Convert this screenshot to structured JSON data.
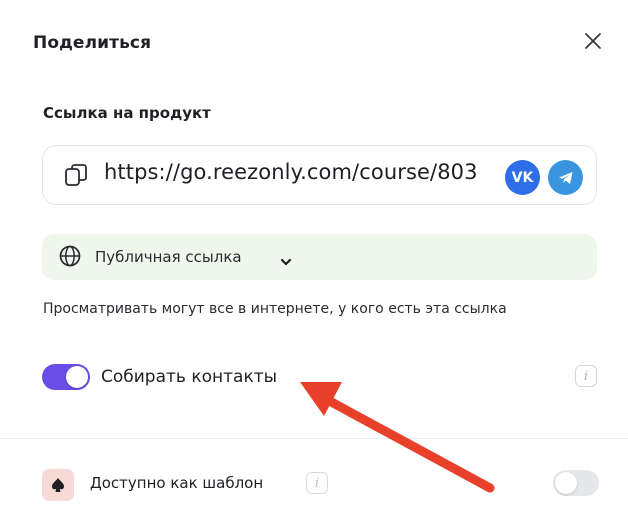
{
  "dialog": {
    "title": "Поделиться"
  },
  "link": {
    "label": "Ссылка на продукт",
    "url": "https://go.reezonly.com/course/803",
    "vk_label": "VK"
  },
  "access": {
    "mode": "Публичная ссылка",
    "description": "Просматривать могут все в интернете, у кого есть эта ссылка"
  },
  "collect_contacts": {
    "label": "Собирать контакты",
    "enabled": true,
    "info_glyph": "i"
  },
  "template": {
    "label": "Доступно как шаблон",
    "enabled": false,
    "info_glyph": "i"
  },
  "icons": {
    "close": "close-icon",
    "copy": "copy-icon",
    "vk": "vk-icon",
    "telegram": "telegram-icon",
    "globe": "globe-icon",
    "chevron": "chevron-down-icon",
    "template": "spade-icon",
    "annotation": "red-arrow-icon"
  },
  "colors": {
    "accent": "#6a4de6",
    "vk": "#2e6ee6",
    "telegram": "#3a95de",
    "access_bg": "#eff7ec",
    "arrow": "#e8402a"
  }
}
